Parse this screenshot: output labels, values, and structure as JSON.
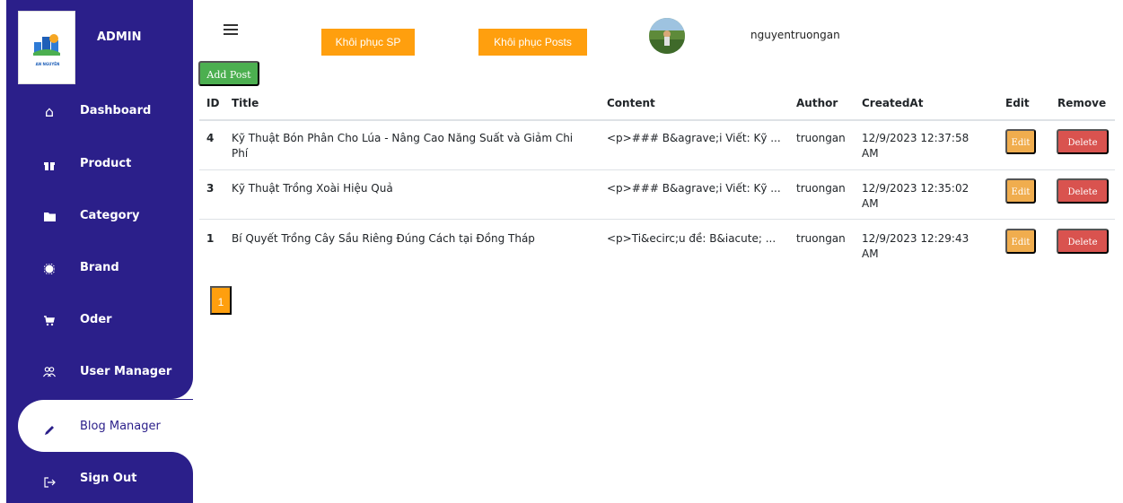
{
  "sidebar": {
    "admin_label": "ADMIN",
    "logo_text": "AN NGUYÊN",
    "items": [
      {
        "label": "Dashboard",
        "icon": "home-icon",
        "glyph": "⌂"
      },
      {
        "label": "Product",
        "icon": "gift-icon",
        "glyph": "🎁"
      },
      {
        "label": "Category",
        "icon": "folder-icon",
        "glyph": "■"
      },
      {
        "label": "Brand",
        "icon": "badge-icon",
        "glyph": "✹"
      },
      {
        "label": "Oder",
        "icon": "cart-icon",
        "glyph": "🛒"
      },
      {
        "label": "User Manager",
        "icon": "users-icon",
        "glyph": "⚇"
      },
      {
        "label": "Blog Manager",
        "icon": "pen-icon",
        "glyph": "✎"
      },
      {
        "label": "Sign Out",
        "icon": "sign-out-icon",
        "glyph": "⇨"
      }
    ],
    "active_index": 6
  },
  "header": {
    "restore_products": "Khôi phục SP",
    "restore_posts": "Khôi phục Posts",
    "username": "nguyentruongan"
  },
  "add_post_label": "Add Post",
  "table": {
    "columns": [
      "ID",
      "Title",
      "Content",
      "Author",
      "CreatedAt",
      "Edit",
      "Remove"
    ],
    "rows": [
      {
        "id": "4",
        "title": "Kỹ Thuật Bón Phân Cho Lúa - Nâng Cao Năng Suất và Giảm Chi Phí",
        "content": "<p>### B&agrave;i Viết: Kỹ ...",
        "author": "truongan",
        "created": "12/9/2023 12:37:58 AM",
        "edit": "Edit",
        "delete": "Delete"
      },
      {
        "id": "3",
        "title": "Kỹ Thuật Trồng Xoài Hiệu Quả",
        "content": "<p>### B&agrave;i Viết: Kỹ ...",
        "author": "truongan",
        "created": "12/9/2023 12:35:02 AM",
        "edit": "Edit",
        "delete": "Delete"
      },
      {
        "id": "1",
        "title": "Bí Quyết Trồng Cây Sầu Riêng Đúng Cách tại Đồng Tháp",
        "content": "<p>Ti&ecirc;u đề: B&iacute; ...",
        "author": "truongan",
        "created": "12/9/2023 12:29:43 AM",
        "edit": "Edit",
        "delete": "Delete"
      }
    ]
  },
  "pagination": {
    "current": "1"
  },
  "colors": {
    "sidebar": "#2b1f8a",
    "accent_orange": "#ff9f0e",
    "add_green": "#4caf50",
    "edit": "#f0ad4e",
    "delete": "#d9534f"
  }
}
